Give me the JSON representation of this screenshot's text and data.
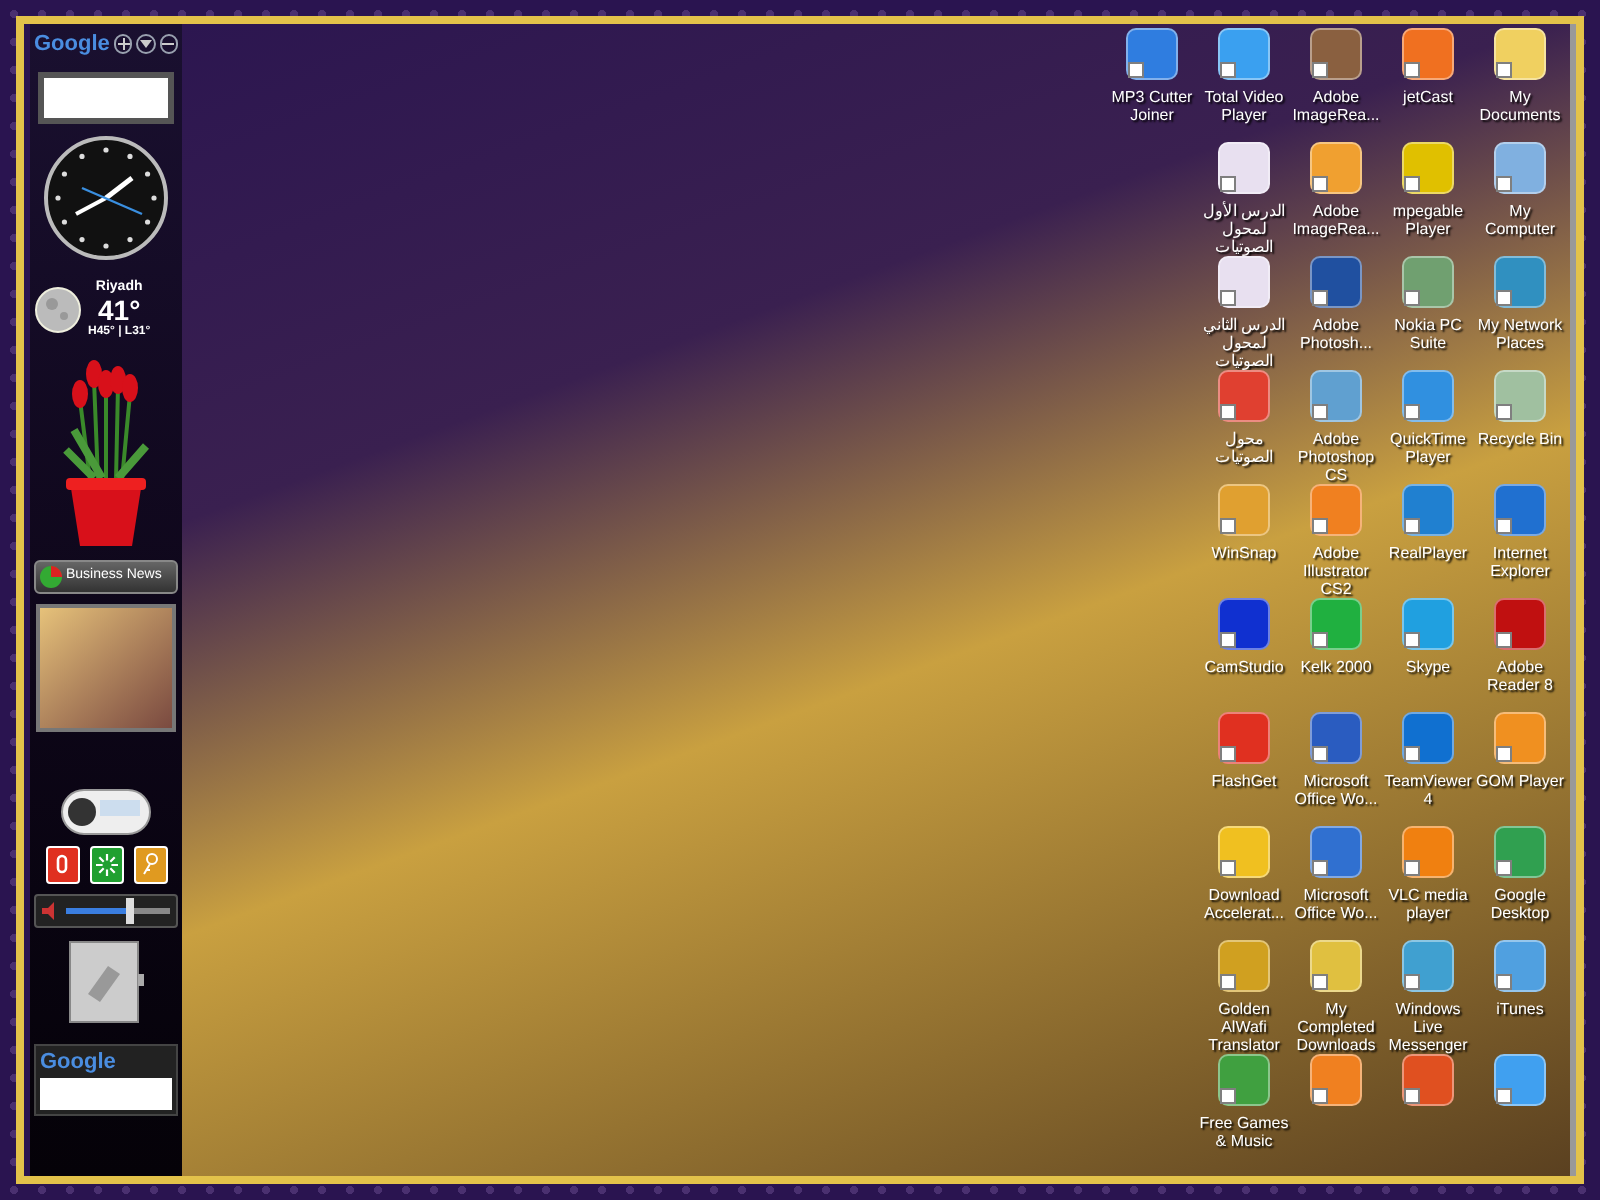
{
  "sidebar": {
    "google_toolbar": {
      "logo": "Google"
    },
    "weather": {
      "city": "Riyadh",
      "temperature": "41°",
      "range": "H45° | L31°"
    },
    "news_button": {
      "label": "Business News"
    },
    "volume": {
      "level": 0.62
    },
    "bottom_search": {
      "logo": "Google"
    }
  },
  "desktop": {
    "columns": [
      [
        {
          "label": "MP3 Cutter Joiner",
          "color": "#2f7de0"
        }
      ],
      [
        {
          "label": "Total Video Player",
          "color": "#3aa0f0"
        },
        {
          "label": "الدرس الأول لمحول الصوتيات",
          "color": "#e8e0f0"
        },
        {
          "label": "الدرس الثاني لمحول الصوتيات",
          "color": "#e8e0f0"
        },
        {
          "label": "محول الصوتيات",
          "color": "#e04030"
        },
        {
          "label": "WinSnap",
          "color": "#e0a030"
        },
        {
          "label": "CamStudio",
          "color": "#1030d0"
        },
        {
          "label": "FlashGet",
          "color": "#e03020"
        },
        {
          "label": "Download Accelerat...",
          "color": "#f0c020"
        },
        {
          "label": "Golden AlWafi Translator",
          "color": "#d0a020"
        },
        {
          "label": "Free Games & Music",
          "color": "#40a040"
        }
      ],
      [
        {
          "label": "Adobe ImageRea...",
          "color": "#8a6040"
        },
        {
          "label": "Adobe ImageRea...",
          "color": "#f0a030"
        },
        {
          "label": "Adobe Photosh...",
          "color": "#2050a0"
        },
        {
          "label": "Adobe Photoshop CS",
          "color": "#60a0d0"
        },
        {
          "label": "Adobe Illustrator CS2",
          "color": "#f08020"
        },
        {
          "label": "Kelk 2000",
          "color": "#20b040"
        },
        {
          "label": "Microsoft Office Wo...",
          "color": "#2a5cc0"
        },
        {
          "label": "Microsoft Office Wo...",
          "color": "#3070d0"
        },
        {
          "label": "My Completed Downloads",
          "color": "#e0c040"
        },
        {
          "color": "#f08020"
        }
      ],
      [
        {
          "label": "jetCast",
          "color": "#f07020"
        },
        {
          "label": "mpegable Player",
          "color": "#e0c000"
        },
        {
          "label": "Nokia PC Suite",
          "color": "#70a070"
        },
        {
          "label": "QuickTime Player",
          "color": "#3090e0"
        },
        {
          "label": "RealPlayer",
          "color": "#2080d0"
        },
        {
          "label": "Skype",
          "color": "#20a0e0"
        },
        {
          "label": "TeamViewer 4",
          "color": "#1070d0"
        },
        {
          "label": "VLC media player",
          "color": "#f08010"
        },
        {
          "label": "Windows Live Messenger",
          "color": "#40a0d0"
        },
        {
          "color": "#e05020"
        }
      ],
      [
        {
          "label": "My Documents",
          "color": "#f0d060"
        },
        {
          "label": "My Computer",
          "color": "#80b0e0"
        },
        {
          "label": "My Network Places",
          "color": "#3090c0"
        },
        {
          "label": "Recycle Bin",
          "color": "#a0c0a0"
        },
        {
          "label": "Internet Explorer",
          "color": "#2070d0"
        },
        {
          "label": "Adobe Reader 8",
          "color": "#c01010"
        },
        {
          "label": "GOM Player",
          "color": "#f09020"
        },
        {
          "label": "Google Desktop",
          "color": "#30a050"
        },
        {
          "label": "iTunes",
          "color": "#50a0e0"
        },
        {
          "color": "#40a0f0"
        }
      ]
    ]
  }
}
